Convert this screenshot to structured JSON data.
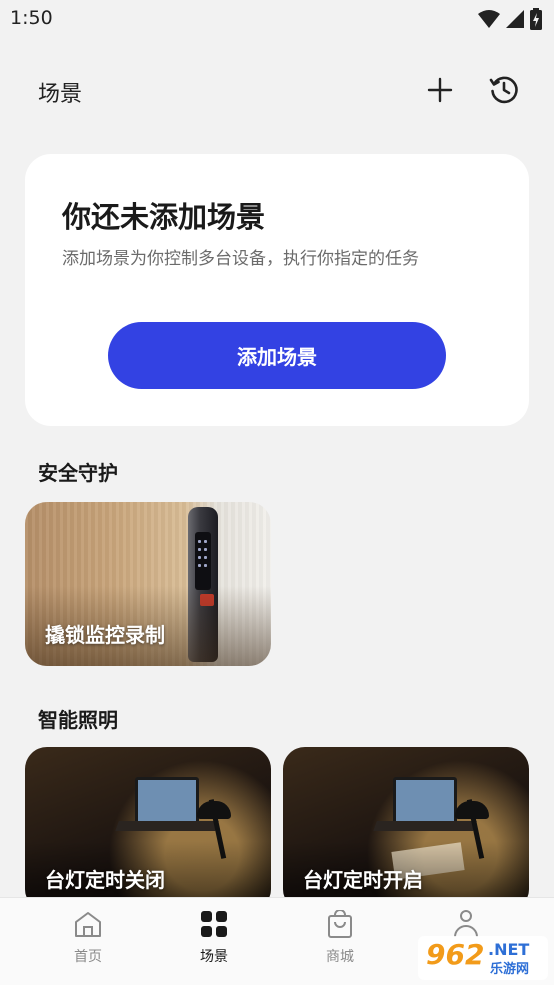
{
  "status_bar": {
    "time": "1:50"
  },
  "header": {
    "title": "场景"
  },
  "empty_state": {
    "title": "你还未添加场景",
    "description": "添加场景为你控制多台设备，执行你指定的任务",
    "button_label": "添加场景"
  },
  "sections": [
    {
      "title": "安全守护",
      "cards": [
        {
          "label": "撬锁监控录制"
        }
      ]
    },
    {
      "title": "智能照明",
      "cards": [
        {
          "label": "台灯定时关闭"
        },
        {
          "label": "台灯定时开启"
        }
      ]
    }
  ],
  "tab_bar": {
    "items": [
      {
        "label": "首页",
        "icon": "home-icon",
        "active": false
      },
      {
        "label": "场景",
        "icon": "grid-icon",
        "active": true
      },
      {
        "label": "商城",
        "icon": "bag-icon",
        "active": false
      },
      {
        "label": "",
        "icon": "person-icon",
        "active": false
      }
    ]
  },
  "watermark": {
    "number": "962",
    "net": ".NET",
    "sub": "乐游网"
  },
  "colors": {
    "accent": "#3342e3",
    "background": "#f2f2f2"
  }
}
